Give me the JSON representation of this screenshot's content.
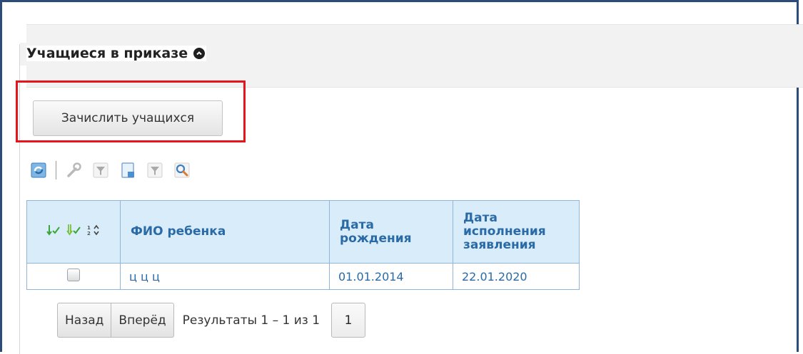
{
  "section": {
    "title": "Учащиеся в приказе"
  },
  "actions": {
    "enroll_label": "Зачислить учащихся"
  },
  "toolbar": {
    "icons": [
      "refresh-icon",
      "settings-wrench-icon",
      "filter-icon",
      "export-icon",
      "filter-clear-icon",
      "search-icon"
    ]
  },
  "table": {
    "headers": {
      "fio": "ФИО ребенка",
      "birth_line1": "Дата",
      "birth_line2": "рождения",
      "exec_line1": "Дата",
      "exec_line2": "исполнения",
      "exec_line3": "заявления"
    },
    "rows": [
      {
        "fio": "ц ц ц",
        "birth_date": "01.01.2014",
        "exec_date": "22.01.2020",
        "checked": false
      }
    ]
  },
  "pager": {
    "prev": "Назад",
    "next": "Вперёд",
    "info": "Результаты 1 – 1 из 1",
    "page": "1"
  },
  "colors": {
    "header_bg": "#d9ecf9",
    "link": "#2a6aa6",
    "highlight": "#e5161b"
  }
}
